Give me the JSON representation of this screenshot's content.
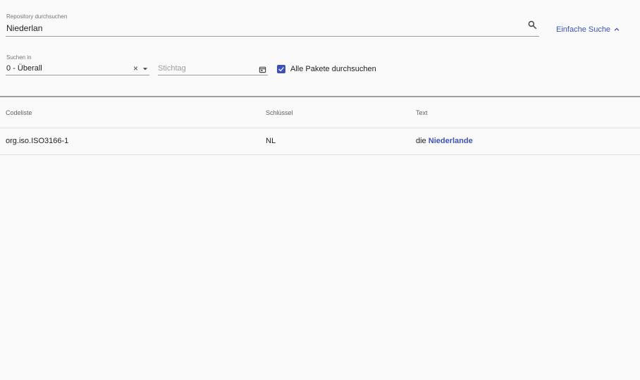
{
  "search": {
    "label": "Repository durchsuchen",
    "value": "Niederlan",
    "toggle_label": "Einfache Suche"
  },
  "filters": {
    "scope_label": "Suchen in",
    "scope_value": "0 - Überall",
    "date_placeholder": "Stichtag",
    "all_packages_label": "Alle Pakete durchsuchen",
    "all_packages_checked": true
  },
  "table": {
    "headers": [
      "Codeliste",
      "Schlüssel",
      "Text"
    ],
    "rows": [
      {
        "codeliste": "org.iso.ISO3166-1",
        "schluessel": "NL",
        "text_prefix": "die ",
        "text_highlight": "Niederlande"
      }
    ]
  },
  "colors": {
    "accent": "#3f51b5",
    "background": "#fafafa",
    "text": "#212121"
  }
}
